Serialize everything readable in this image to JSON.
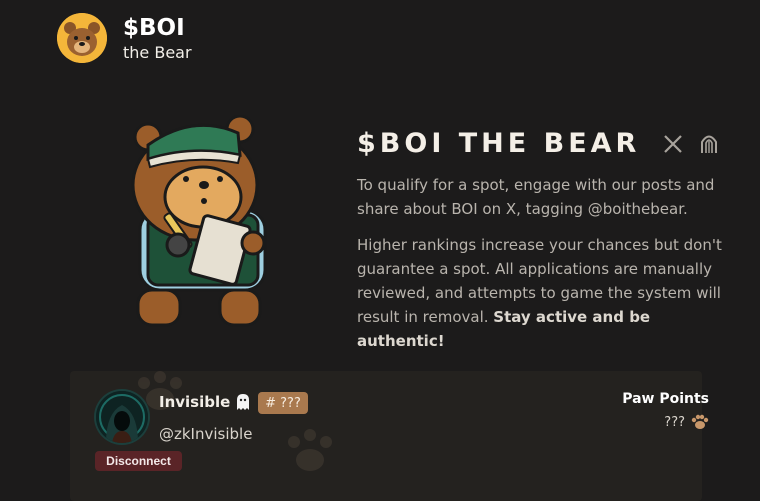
{
  "brand": {
    "title": "$BOI",
    "subtitle": "the Bear"
  },
  "hero": {
    "title": "$BOI THE BEAR",
    "paragraph1": "To qualify for a spot, engage with our posts and share about BOI on X, tagging @boithebear.",
    "paragraph2_text": "Higher rankings increase your chances but don't guarantee a spot. All applications are manually reviewed, and attempts to game the system will result in removal.",
    "paragraph2_emphasis": "Stay active and be authentic!",
    "social_icons": [
      "x-icon",
      "stamp-icon"
    ]
  },
  "profile": {
    "name": "Invisible",
    "name_icon": "ghost-icon",
    "rank": "# ???",
    "handle": "@zkInvisible",
    "disconnect_label": "Disconnect",
    "points_label": "Paw Points",
    "points_value": "???",
    "points_icon": "paw-icon"
  },
  "colors": {
    "background": "#1c1b1b",
    "card": "#24221f",
    "rank_badge": "#a9794e",
    "disconnect": "#5a2427",
    "logo_bg": "#f4b63a"
  }
}
